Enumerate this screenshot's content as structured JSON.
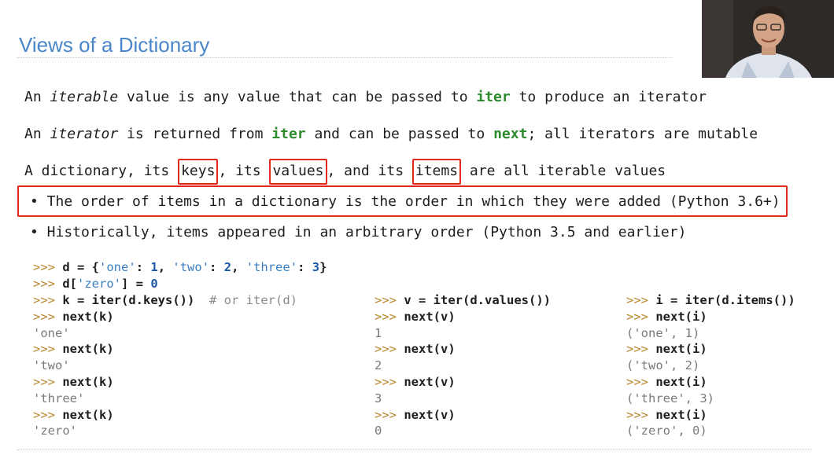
{
  "slide": {
    "title": "Views of a Dictionary"
  },
  "text": {
    "l1": {
      "a": "An ",
      "em": "iterable",
      "b": " value is any value that can be passed to ",
      "kw": "iter",
      "c": " to produce an iterator"
    },
    "l2": {
      "a": "An ",
      "em": "iterator",
      "b": " is returned from ",
      "kw1": "iter",
      "c": " and can be passed to ",
      "kw2": "next",
      "d": "; all iterators are mutable"
    },
    "l3": {
      "a": "A dictionary, its ",
      "keys": "keys",
      "b": ", its ",
      "values": "values",
      "c": ", and its ",
      "items": "items",
      "d": " are all iterable values"
    },
    "bullet1": "• The order of items in a dictionary is the order in which they were added (Python 3.6+)",
    "bullet2": "• Historically, items appeared in an arbitrary order (Python 3.5 and earlier)"
  },
  "code": {
    "prompt": ">>>",
    "top": {
      "l1": {
        "a": "d = {",
        "s1": "'one'",
        "b": ": ",
        "n1": "1",
        "c": ", ",
        "s2": "'two'",
        "d": ": ",
        "n2": "2",
        "e": ", ",
        "s3": "'three'",
        "f": ": ",
        "n3": "3",
        "g": "}"
      },
      "l2": {
        "a": "d[",
        "s": "'zero'",
        "b": "] = ",
        "n": "0"
      }
    },
    "col1": {
      "stmt": "k = iter(d.keys())",
      "comment": "# or iter(d)",
      "call": "next(k)",
      "outputs": [
        "'one'",
        "'two'",
        "'three'",
        "'zero'"
      ]
    },
    "col2": {
      "stmt": "v = iter(d.values())",
      "call": "next(v)",
      "outputs": [
        "1",
        "2",
        "3",
        "0"
      ]
    },
    "col3": {
      "stmt": "i = iter(d.items())",
      "call": "next(i)",
      "outputs": [
        "('one', 1)",
        "('two', 2)",
        "('three', 3)",
        "('zero', 0)"
      ]
    }
  }
}
